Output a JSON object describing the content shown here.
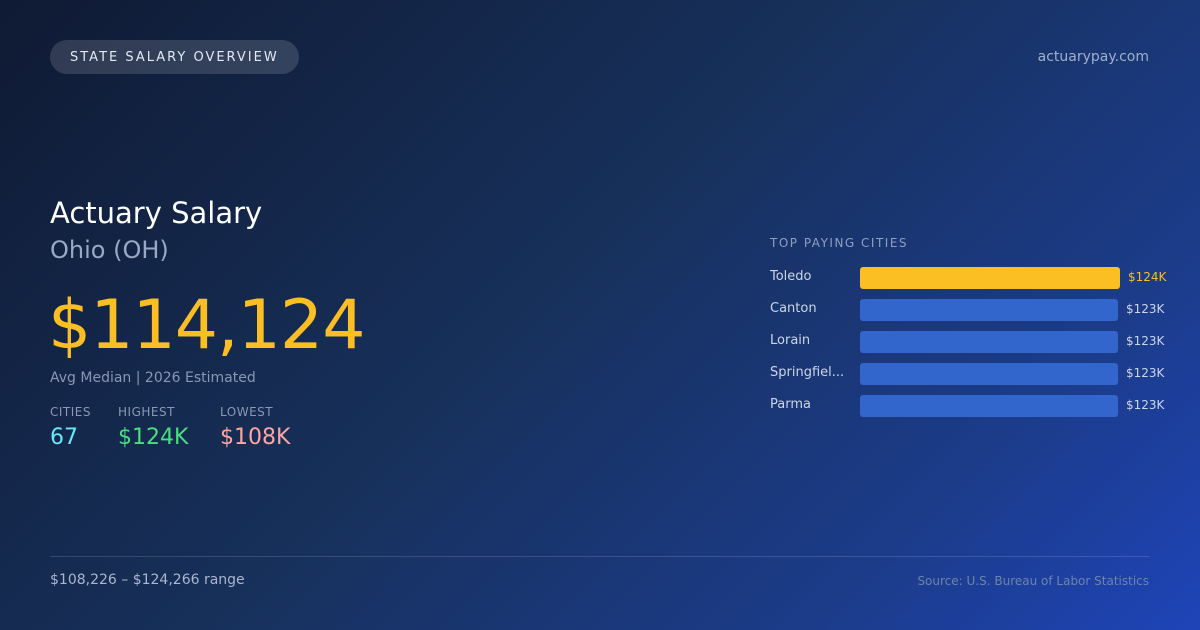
{
  "header": {
    "badge": "STATE SALARY OVERVIEW",
    "site": "actuarypay.com"
  },
  "hero": {
    "title": "Actuary Salary",
    "subtitle": "Ohio (OH)",
    "amount": "$114,124",
    "caption": "Avg Median | 2026 Estimated"
  },
  "stats": {
    "cities_label": "CITIES",
    "cities_value": "67",
    "highest_label": "HIGHEST",
    "highest_value": "$124K",
    "lowest_label": "LOWEST",
    "lowest_value": "$108K"
  },
  "colors": {
    "accent": "#fbbf24",
    "bar": "#3366cc",
    "cities": "#67e8f9",
    "highest": "#4ade80",
    "lowest": "#fca5a5"
  },
  "chart_data": {
    "type": "bar",
    "title": "TOP PAYING CITIES",
    "categories": [
      "Toledo",
      "Canton",
      "Lorain",
      "Springfiel...",
      "Parma"
    ],
    "values": [
      124,
      123,
      123,
      123,
      123
    ],
    "value_labels": [
      "$124K",
      "$123K",
      "$123K",
      "$123K",
      "$123K"
    ],
    "highlight_index": 0
  },
  "footer": {
    "range": "$108,226 – $124,266 range",
    "source": "Source: U.S. Bureau of Labor Statistics"
  }
}
